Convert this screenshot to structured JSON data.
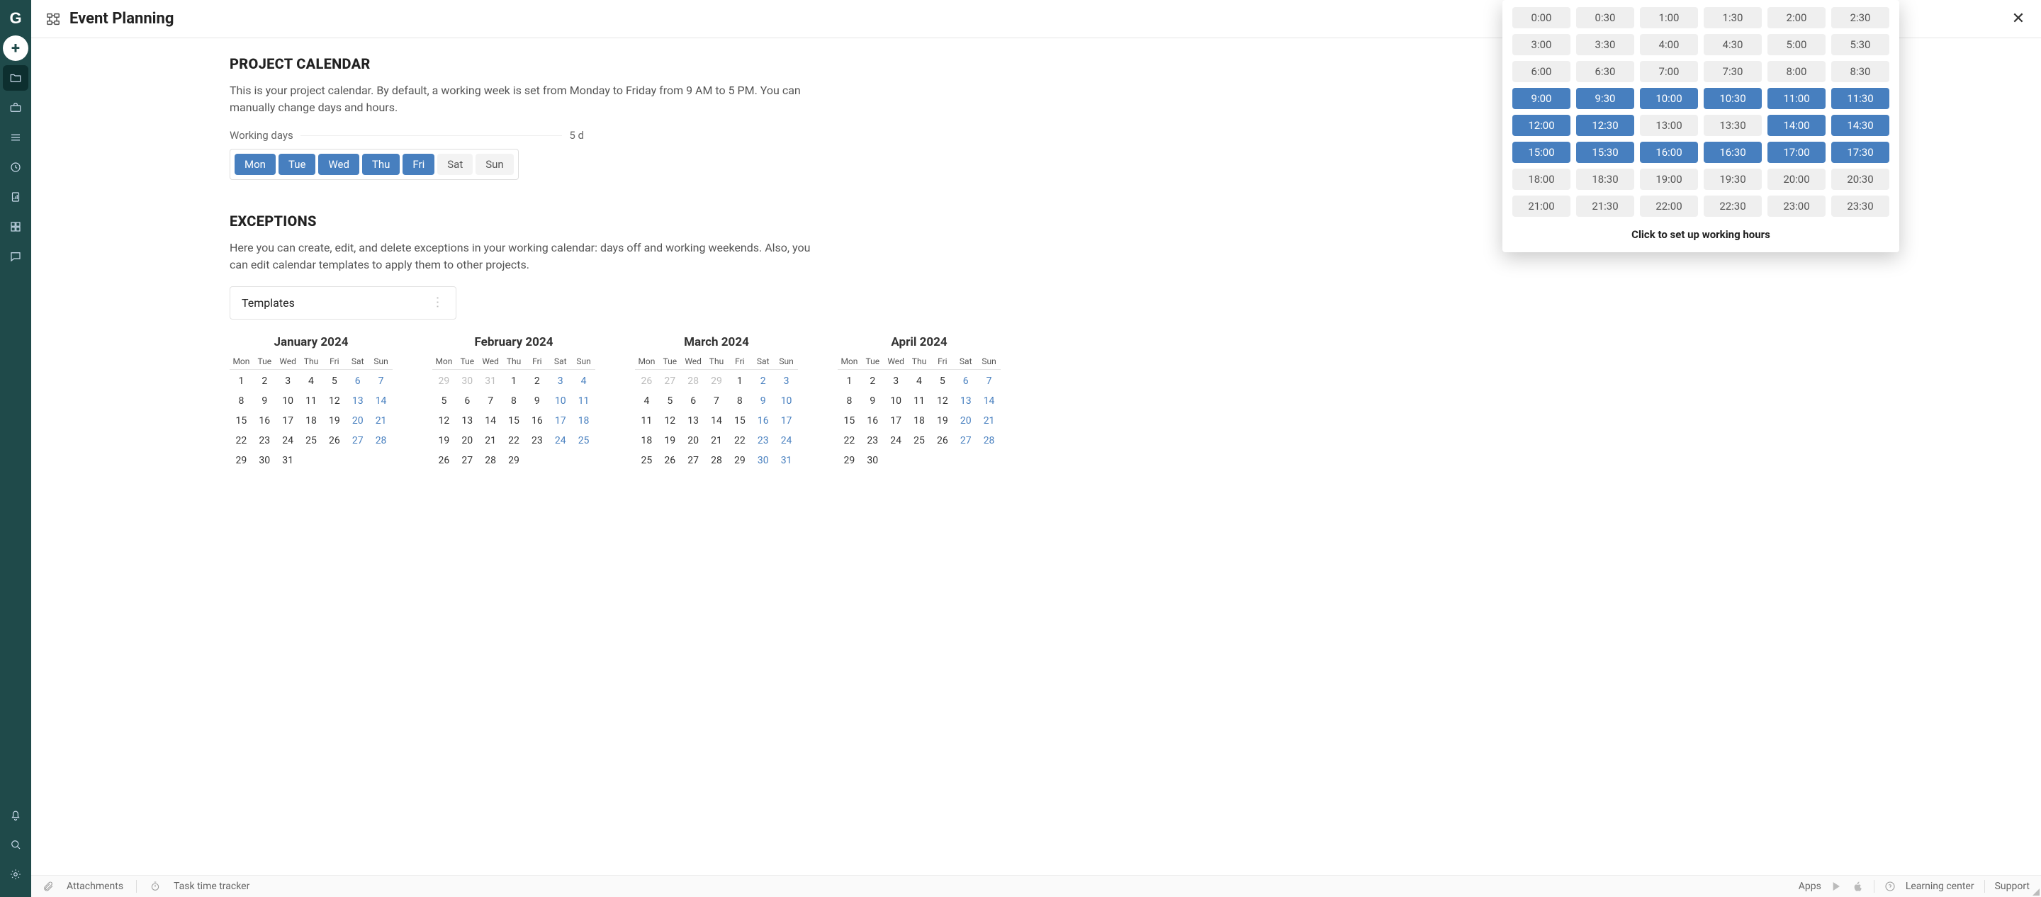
{
  "page_title": "Event Planning",
  "project_calendar": {
    "heading": "PROJECT CALENDAR",
    "description": "This is your project calendar. By default, a working week is set from Monday to Friday from 9 AM to 5 PM. You can manually change days and hours.",
    "working_days_label": "Working days",
    "working_days_value": "5 d",
    "days": [
      {
        "label": "Mon",
        "active": true
      },
      {
        "label": "Tue",
        "active": true
      },
      {
        "label": "Wed",
        "active": true
      },
      {
        "label": "Thu",
        "active": true
      },
      {
        "label": "Fri",
        "active": true
      },
      {
        "label": "Sat",
        "active": false
      },
      {
        "label": "Sun",
        "active": false
      }
    ]
  },
  "exceptions": {
    "heading": "EXCEPTIONS",
    "description": "Here you can create, edit, and delete exceptions in your working calendar: days off and working weekends. Also, you can edit calendar templates to apply them to other projects.",
    "templates_label": "Templates"
  },
  "calendars": {
    "dow_labels": [
      "Mon",
      "Tue",
      "Wed",
      "Thu",
      "Fri",
      "Sat",
      "Sun"
    ],
    "months": [
      {
        "title": "January 2024",
        "lead_muted": 0,
        "first_weekday": 0,
        "days": 31,
        "weekend_dom": [
          6,
          7,
          13,
          14,
          20,
          21,
          27,
          28
        ]
      },
      {
        "title": "February 2024",
        "lead_muted": 3,
        "lead_values": [
          29,
          30,
          31
        ],
        "first_weekday": 3,
        "days": 29,
        "weekend_dom": [
          3,
          4,
          10,
          11,
          17,
          18,
          24,
          25
        ]
      },
      {
        "title": "March 2024",
        "lead_muted": 4,
        "lead_values": [
          26,
          27,
          28,
          29
        ],
        "first_weekday": 4,
        "days": 31,
        "weekend_dom": [
          2,
          3,
          9,
          10,
          16,
          17,
          23,
          24,
          30,
          31
        ]
      },
      {
        "title": "April 2024",
        "lead_muted": 0,
        "first_weekday": 0,
        "days": 30,
        "weekend_dom": [
          6,
          7,
          13,
          14,
          20,
          21,
          27,
          28
        ]
      }
    ]
  },
  "time_picker": {
    "caption": "Click to set up working hours",
    "slots": [
      {
        "t": "0:00",
        "on": false
      },
      {
        "t": "0:30",
        "on": false
      },
      {
        "t": "1:00",
        "on": false
      },
      {
        "t": "1:30",
        "on": false
      },
      {
        "t": "2:00",
        "on": false
      },
      {
        "t": "2:30",
        "on": false
      },
      {
        "t": "3:00",
        "on": false
      },
      {
        "t": "3:30",
        "on": false
      },
      {
        "t": "4:00",
        "on": false
      },
      {
        "t": "4:30",
        "on": false
      },
      {
        "t": "5:00",
        "on": false
      },
      {
        "t": "5:30",
        "on": false
      },
      {
        "t": "6:00",
        "on": false
      },
      {
        "t": "6:30",
        "on": false
      },
      {
        "t": "7:00",
        "on": false
      },
      {
        "t": "7:30",
        "on": false
      },
      {
        "t": "8:00",
        "on": false
      },
      {
        "t": "8:30",
        "on": false
      },
      {
        "t": "9:00",
        "on": true
      },
      {
        "t": "9:30",
        "on": true
      },
      {
        "t": "10:00",
        "on": true
      },
      {
        "t": "10:30",
        "on": true
      },
      {
        "t": "11:00",
        "on": true
      },
      {
        "t": "11:30",
        "on": true
      },
      {
        "t": "12:00",
        "on": true
      },
      {
        "t": "12:30",
        "on": true
      },
      {
        "t": "13:00",
        "on": false
      },
      {
        "t": "13:30",
        "on": false
      },
      {
        "t": "14:00",
        "on": true
      },
      {
        "t": "14:30",
        "on": true
      },
      {
        "t": "15:00",
        "on": true
      },
      {
        "t": "15:30",
        "on": true
      },
      {
        "t": "16:00",
        "on": true
      },
      {
        "t": "16:30",
        "on": true
      },
      {
        "t": "17:00",
        "on": true
      },
      {
        "t": "17:30",
        "on": true
      },
      {
        "t": "18:00",
        "on": false
      },
      {
        "t": "18:30",
        "on": false
      },
      {
        "t": "19:00",
        "on": false
      },
      {
        "t": "19:30",
        "on": false
      },
      {
        "t": "20:00",
        "on": false
      },
      {
        "t": "20:30",
        "on": false
      },
      {
        "t": "21:00",
        "on": false
      },
      {
        "t": "21:30",
        "on": false
      },
      {
        "t": "22:00",
        "on": false
      },
      {
        "t": "22:30",
        "on": false
      },
      {
        "t": "23:00",
        "on": false
      },
      {
        "t": "23:30",
        "on": false
      }
    ]
  },
  "footer": {
    "attachments": "Attachments",
    "task_time_tracker": "Task time tracker",
    "apps": "Apps",
    "learning_center": "Learning center",
    "support": "Support"
  }
}
